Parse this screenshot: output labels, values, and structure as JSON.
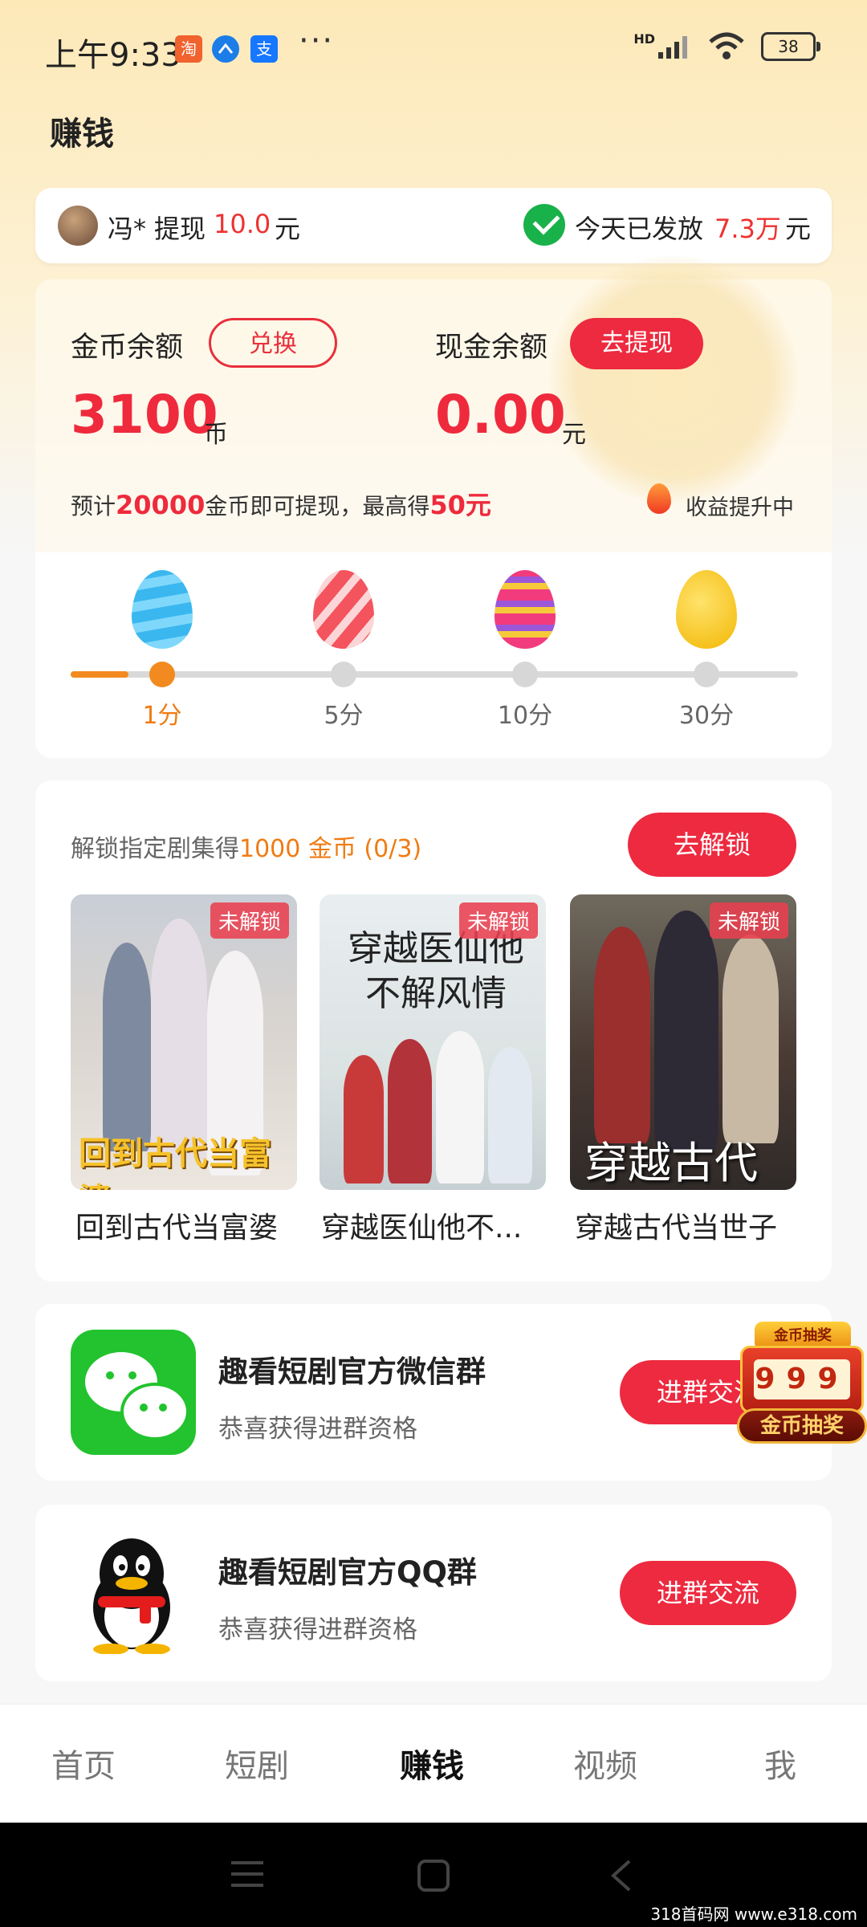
{
  "status_bar": {
    "time": "上午9:33",
    "app_icons": [
      "淘",
      "支"
    ],
    "more": "···",
    "network": "HD",
    "battery": "38"
  },
  "page": {
    "title": "赚钱"
  },
  "notice": {
    "user": "冯*",
    "action": "提现",
    "amount": "10.0",
    "unit": "元",
    "today_label": "今天已发放",
    "today_amount": "7.3万",
    "today_unit": "元"
  },
  "balance": {
    "coin_label": "金币余额",
    "exchange_btn": "兑换",
    "coin_value": "3100",
    "coin_unit": "币",
    "cash_label": "现金余额",
    "withdraw_btn": "去提现",
    "cash_value": "0.00",
    "cash_unit": "元",
    "hint_prefix": "预计",
    "hint_coins": "20000",
    "hint_mid": "金币即可提现，最高得",
    "hint_max": "50元",
    "rising": "收益提升中"
  },
  "milestones": {
    "items": [
      {
        "label": "1分",
        "active": true
      },
      {
        "label": "5分",
        "active": false
      },
      {
        "label": "10分",
        "active": false
      },
      {
        "label": "30分",
        "active": false
      }
    ],
    "progress": 0.08
  },
  "unlock": {
    "heading_prefix": "解锁指定剧集得",
    "heading_reward": "1000 金币 (0/3)",
    "button": "去解锁",
    "dramas": [
      {
        "title": "回到古代当富婆",
        "tag": "未解锁",
        "poster_text": "回到古代当富婆"
      },
      {
        "title": "穿越医仙他不...",
        "tag": "未解锁",
        "poster_text": "穿越医仙他不解风情"
      },
      {
        "title": "穿越古代当世子",
        "tag": "未解锁",
        "poster_text": "穿越古代"
      }
    ]
  },
  "groups": [
    {
      "title": "趣看短剧官方微信群",
      "subtitle": "恭喜获得进群资格",
      "button": "进群交流"
    },
    {
      "title": "趣看短剧官方QQ群",
      "subtitle": "恭喜获得进群资格",
      "button": "进群交流"
    }
  ],
  "lottery": {
    "top": "金币抽奖",
    "digits": "999",
    "bottom": "金币抽奖"
  },
  "tabs": [
    "首页",
    "短剧",
    "赚钱",
    "视频",
    "我"
  ],
  "active_tab": "赚钱",
  "watermark": "318首码网 www.e318.com"
}
